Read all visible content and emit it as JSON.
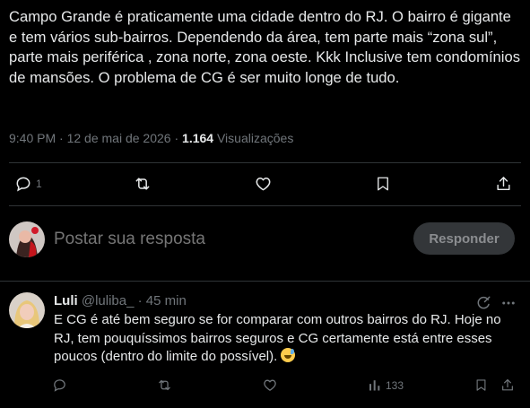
{
  "post": {
    "text": "Campo Grande é praticamente uma cidade dentro do RJ. O bairro é gigante e tem vários sub-bairros. Dependendo da área, tem parte mais “zona sul”, parte mais periférica , zona norte, zona oeste. Kkk Inclusive tem condomínios de mansões. O problema de CG é ser muito longe de tudo.",
    "time": "9:40 PM",
    "date": "12 de mai de 2026",
    "views_count": "1.164",
    "views_label": "Visualizações",
    "reply_count": "1"
  },
  "compose": {
    "placeholder": "Postar sua resposta",
    "button_label": "Responder"
  },
  "reply": {
    "name": "Luli",
    "handle": "@luliba_",
    "age": "45 min",
    "text": "E CG é até bem seguro se for comparar com outros bairros do RJ. Hoje no RJ, tem pouquíssimos bairros seguros e CG certamente está entre esses poucos (dentro do limite do possível).",
    "views": "133"
  },
  "icons": [
    "reply-icon",
    "repost-icon",
    "like-icon",
    "bookmark-icon",
    "share-icon",
    "grok-icon",
    "more-icon",
    "views-icon"
  ],
  "colors": {
    "background": "#000000",
    "text": "#e7e9ea",
    "muted": "#71767b",
    "divider": "#2f3336",
    "button_bg": "#333639"
  }
}
